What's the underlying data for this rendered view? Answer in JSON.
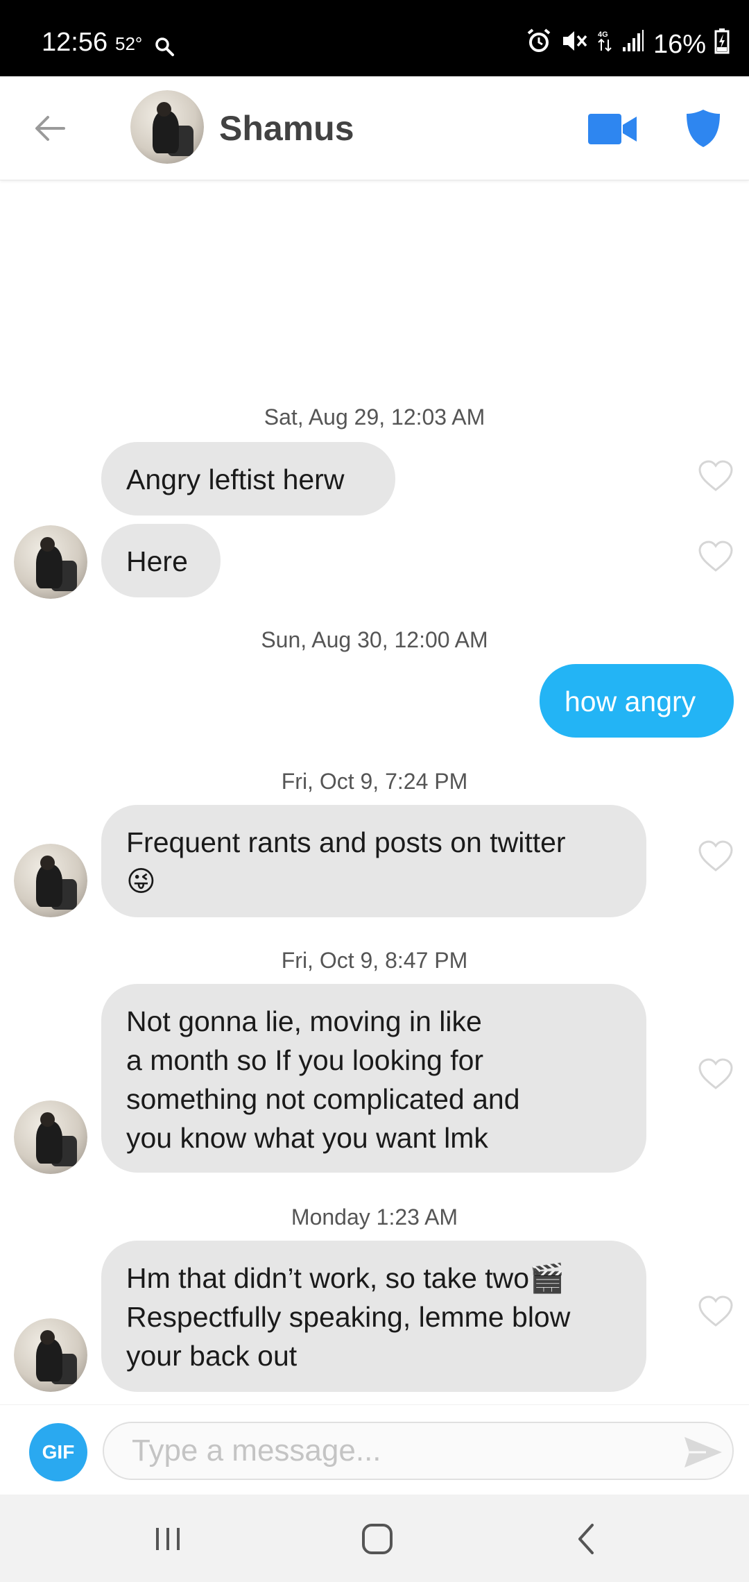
{
  "status_bar": {
    "time": "12:56",
    "temperature": "52°",
    "battery": "16%",
    "icons": [
      "search-icon",
      "alarm-icon",
      "mute-icon",
      "4g-data-icon",
      "signal-icon",
      "battery-charging-icon"
    ]
  },
  "header": {
    "contact_name": "Shamus",
    "icons": [
      "back-arrow-icon",
      "video-call-icon",
      "shield-icon"
    ],
    "accent_color": "#2e86f0"
  },
  "messages": [
    {
      "date": "Sat, Aug 29, 12:03 AM"
    },
    {
      "direction": "in",
      "text": "Angry leftist herw"
    },
    {
      "direction": "in",
      "text": "Here"
    },
    {
      "date": "Sun, Aug 30, 12:00 AM"
    },
    {
      "direction": "out",
      "text": "how angry"
    },
    {
      "date": "Fri, Oct 9, 7:24 PM"
    },
    {
      "direction": "in",
      "text": "Frequent rants and posts on twitter",
      "emoji": "😜"
    },
    {
      "date": "Fri, Oct 9, 8:47 PM"
    },
    {
      "direction": "in",
      "lines": [
        "Not gonna lie, moving in like",
        "a month so If you looking for",
        "something not complicated and",
        "you know what you want lmk"
      ]
    },
    {
      "date": "Monday 1:23 AM"
    },
    {
      "direction": "in",
      "lines": [
        "Hm that didn’t work, so take two🎬",
        "Respectfully speaking, lemme blow",
        "your back out"
      ]
    }
  ],
  "composer": {
    "gif_label": "GIF",
    "placeholder": "Type a message...",
    "value": ""
  },
  "colors": {
    "incoming_bubble": "#e6e6e6",
    "outgoing_bubble": "#23b4f5",
    "gif_button": "#2aa9f0"
  },
  "nav_bar": {
    "icons": [
      "recent-apps-icon",
      "home-icon",
      "back-icon"
    ]
  }
}
